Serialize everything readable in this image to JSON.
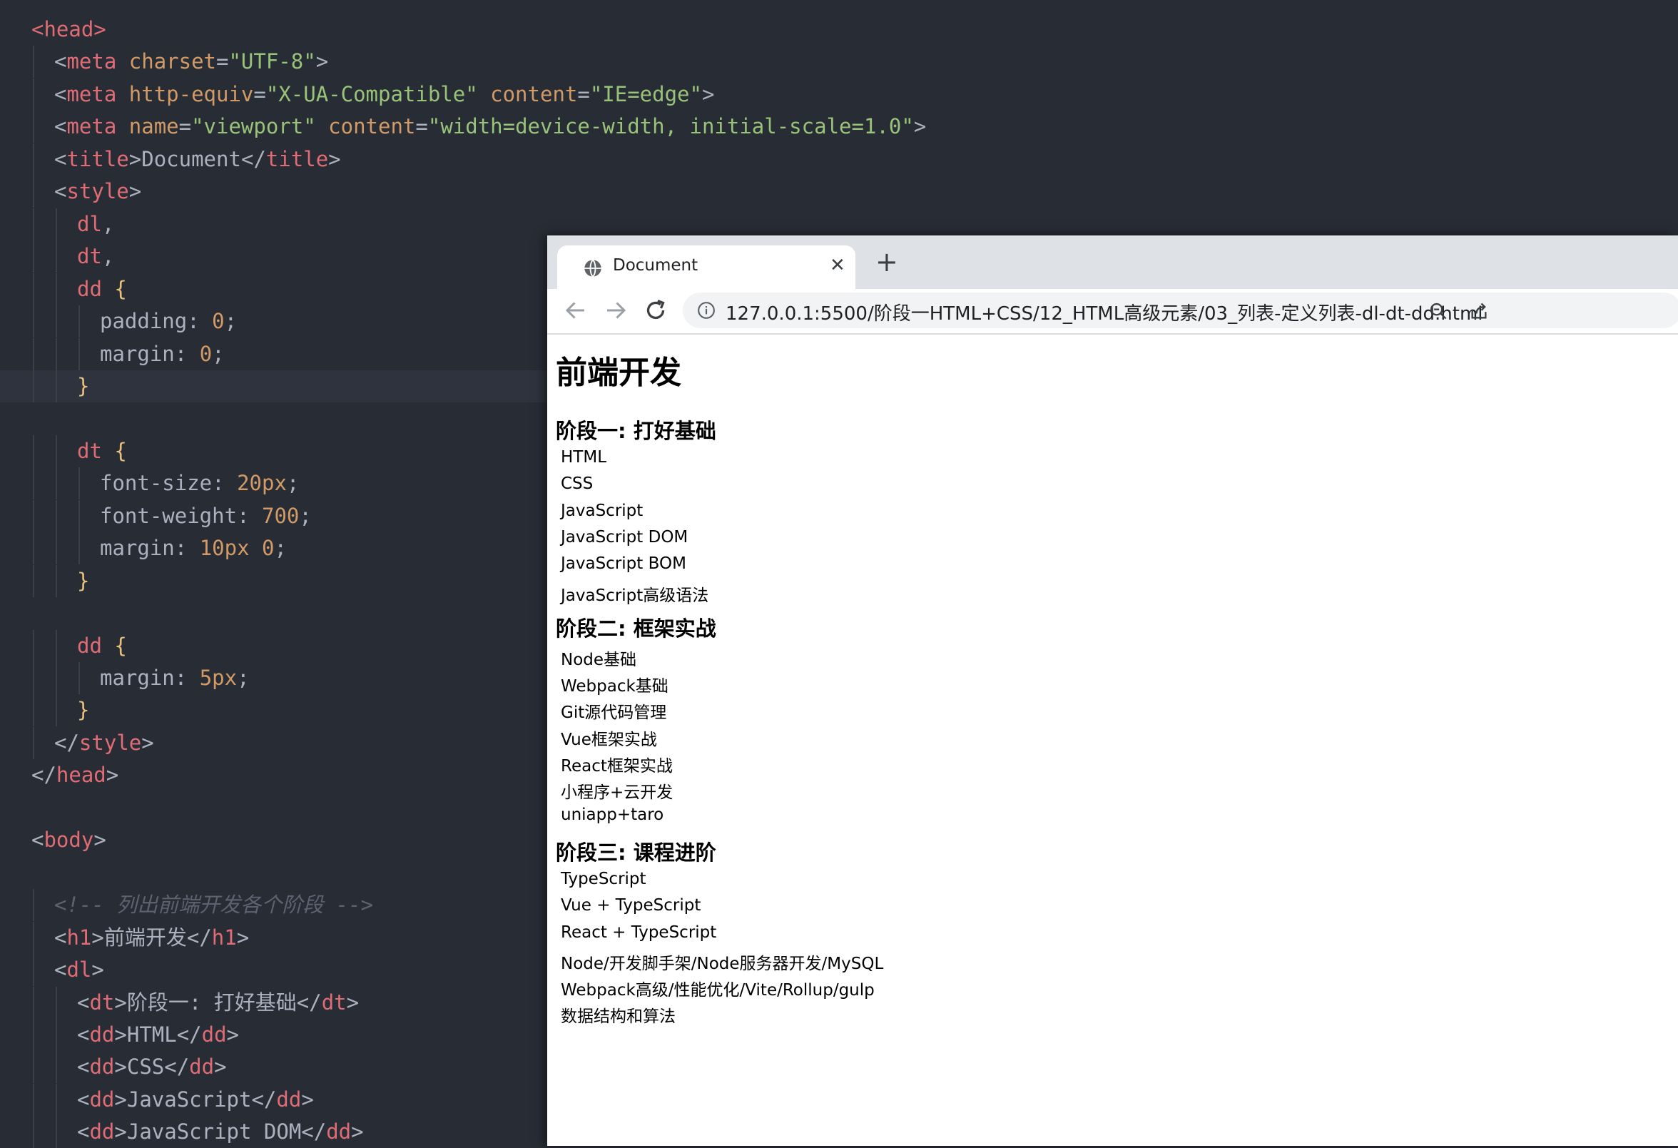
{
  "editor": {
    "lines": [
      [
        [
          "tg",
          "<head>"
        ]
      ],
      [
        [
          "pu",
          "<"
        ],
        [
          "tg",
          "meta"
        ],
        [
          "pu",
          " "
        ],
        [
          "at",
          "charset"
        ],
        [
          "pu",
          "="
        ],
        [
          "st",
          "\"UTF-8\""
        ],
        [
          "pu",
          ">"
        ]
      ],
      [
        [
          "pu",
          "<"
        ],
        [
          "tg",
          "meta"
        ],
        [
          "pu",
          " "
        ],
        [
          "at",
          "http-equiv"
        ],
        [
          "pu",
          "="
        ],
        [
          "st",
          "\"X-UA-Compatible\""
        ],
        [
          "pu",
          " "
        ],
        [
          "at",
          "content"
        ],
        [
          "pu",
          "="
        ],
        [
          "st",
          "\"IE=edge\""
        ],
        [
          "pu",
          ">"
        ]
      ],
      [
        [
          "pu",
          "<"
        ],
        [
          "tg",
          "meta"
        ],
        [
          "pu",
          " "
        ],
        [
          "at",
          "name"
        ],
        [
          "pu",
          "="
        ],
        [
          "st",
          "\"viewport\""
        ],
        [
          "pu",
          " "
        ],
        [
          "at",
          "content"
        ],
        [
          "pu",
          "="
        ],
        [
          "st",
          "\"width=device-width, initial-scale=1.0\""
        ],
        [
          "pu",
          ">"
        ]
      ],
      [
        [
          "pu",
          "<"
        ],
        [
          "tg",
          "title"
        ],
        [
          "pu",
          ">"
        ],
        [
          "tx",
          "Document"
        ],
        [
          "pu",
          "</"
        ],
        [
          "tg",
          "title"
        ],
        [
          "pu",
          ">"
        ]
      ],
      [
        [
          "pu",
          "<"
        ],
        [
          "tg",
          "style"
        ],
        [
          "pu",
          ">"
        ]
      ],
      [
        [
          "tg",
          "dl"
        ],
        [
          "pu",
          ","
        ]
      ],
      [
        [
          "tg",
          "dt"
        ],
        [
          "pu",
          ","
        ]
      ],
      [
        [
          "tg",
          "dd"
        ],
        [
          "pu",
          " "
        ],
        [
          "br",
          "{"
        ]
      ],
      [
        [
          "pr",
          "padding"
        ],
        [
          "pu",
          ": "
        ],
        [
          "nm",
          "0"
        ],
        [
          "pu",
          ";"
        ]
      ],
      [
        [
          "pr",
          "margin"
        ],
        [
          "pu",
          ": "
        ],
        [
          "nm",
          "0"
        ],
        [
          "pu",
          ";"
        ]
      ],
      [
        [
          "br",
          "}"
        ]
      ],
      [],
      [
        [
          "tg",
          "dt"
        ],
        [
          "pu",
          " "
        ],
        [
          "br",
          "{"
        ]
      ],
      [
        [
          "pr",
          "font-size"
        ],
        [
          "pu",
          ": "
        ],
        [
          "nm",
          "20px"
        ],
        [
          "pu",
          ";"
        ]
      ],
      [
        [
          "pr",
          "font-weight"
        ],
        [
          "pu",
          ": "
        ],
        [
          "nm",
          "700"
        ],
        [
          "pu",
          ";"
        ]
      ],
      [
        [
          "pr",
          "margin"
        ],
        [
          "pu",
          ": "
        ],
        [
          "nm",
          "10px 0"
        ],
        [
          "pu",
          ";"
        ]
      ],
      [
        [
          "br",
          "}"
        ]
      ],
      [],
      [
        [
          "tg",
          "dd"
        ],
        [
          "pu",
          " "
        ],
        [
          "br",
          "{"
        ]
      ],
      [
        [
          "pr",
          "margin"
        ],
        [
          "pu",
          ": "
        ],
        [
          "nm",
          "5px"
        ],
        [
          "pu",
          ";"
        ]
      ],
      [
        [
          "br",
          "}"
        ]
      ],
      [
        [
          "pu",
          "</"
        ],
        [
          "tg",
          "style"
        ],
        [
          "pu",
          ">"
        ]
      ],
      [
        [
          "pu",
          "</"
        ],
        [
          "tg",
          "head"
        ],
        [
          "pu",
          ">"
        ]
      ],
      [],
      [
        [
          "pu",
          "<"
        ],
        [
          "tg",
          "body"
        ],
        [
          "pu",
          ">"
        ]
      ],
      [],
      [
        [
          "cm",
          "<!-- 列出前端开发各个阶段 -->"
        ]
      ],
      [
        [
          "pu",
          "<"
        ],
        [
          "tg",
          "h1"
        ],
        [
          "pu",
          ">"
        ],
        [
          "tx",
          "前端开发"
        ],
        [
          "pu",
          "</"
        ],
        [
          "tg",
          "h1"
        ],
        [
          "pu",
          ">"
        ]
      ],
      [
        [
          "pu",
          "<"
        ],
        [
          "tg",
          "dl"
        ],
        [
          "pu",
          ">"
        ]
      ],
      [
        [
          "pu",
          "<"
        ],
        [
          "tg",
          "dt"
        ],
        [
          "pu",
          ">"
        ],
        [
          "tx",
          "阶段一: 打好基础"
        ],
        [
          "pu",
          "</"
        ],
        [
          "tg",
          "dt"
        ],
        [
          "pu",
          ">"
        ]
      ],
      [
        [
          "pu",
          "<"
        ],
        [
          "tg",
          "dd"
        ],
        [
          "pu",
          ">"
        ],
        [
          "tx",
          "HTML"
        ],
        [
          "pu",
          "</"
        ],
        [
          "tg",
          "dd"
        ],
        [
          "pu",
          ">"
        ]
      ],
      [
        [
          "pu",
          "<"
        ],
        [
          "tg",
          "dd"
        ],
        [
          "pu",
          ">"
        ],
        [
          "tx",
          "CSS"
        ],
        [
          "pu",
          "</"
        ],
        [
          "tg",
          "dd"
        ],
        [
          "pu",
          ">"
        ]
      ],
      [
        [
          "pu",
          "<"
        ],
        [
          "tg",
          "dd"
        ],
        [
          "pu",
          ">"
        ],
        [
          "tx",
          "JavaScript"
        ],
        [
          "pu",
          "</"
        ],
        [
          "tg",
          "dd"
        ],
        [
          "pu",
          ">"
        ]
      ],
      [
        [
          "pu",
          "<"
        ],
        [
          "tg",
          "dd"
        ],
        [
          "pu",
          ">"
        ],
        [
          "tx",
          "JavaScript DOM"
        ],
        [
          "pu",
          "</"
        ],
        [
          "tg",
          "dd"
        ],
        [
          "pu",
          ">"
        ]
      ]
    ]
  },
  "browser": {
    "tab_title": "Document",
    "close_glyph": "✕",
    "new_tab_glyph": "+",
    "url_host": "127.0.0.1",
    "url_path": ":5500/阶段一HTML+CSS/12_HTML高级元素/03_列表-定义列表-dl-dt-dd.html"
  },
  "page": {
    "h1": "前端开发",
    "sections": [
      {
        "title": "阶段一: 打好基础",
        "items": [
          "HTML",
          "CSS",
          "JavaScript",
          "JavaScript DOM",
          "JavaScript BOM",
          "JavaScript高级语法"
        ]
      },
      {
        "title": "阶段二: 框架实战",
        "items": [
          "Node基础",
          "Webpack基础",
          "Git源代码管理",
          "Vue框架实战",
          "React框架实战",
          "小程序+云开发",
          "uniapp+taro"
        ]
      },
      {
        "title": "阶段三: 课程进阶",
        "items": [
          "TypeScript",
          "Vue + TypeScript",
          "React + TypeScript",
          "Node/开发脚手架/Node服务器开发/MySQL",
          "Webpack高级/性能优化/Vite/Rollup/gulp",
          "数据结构和算法"
        ]
      }
    ]
  }
}
